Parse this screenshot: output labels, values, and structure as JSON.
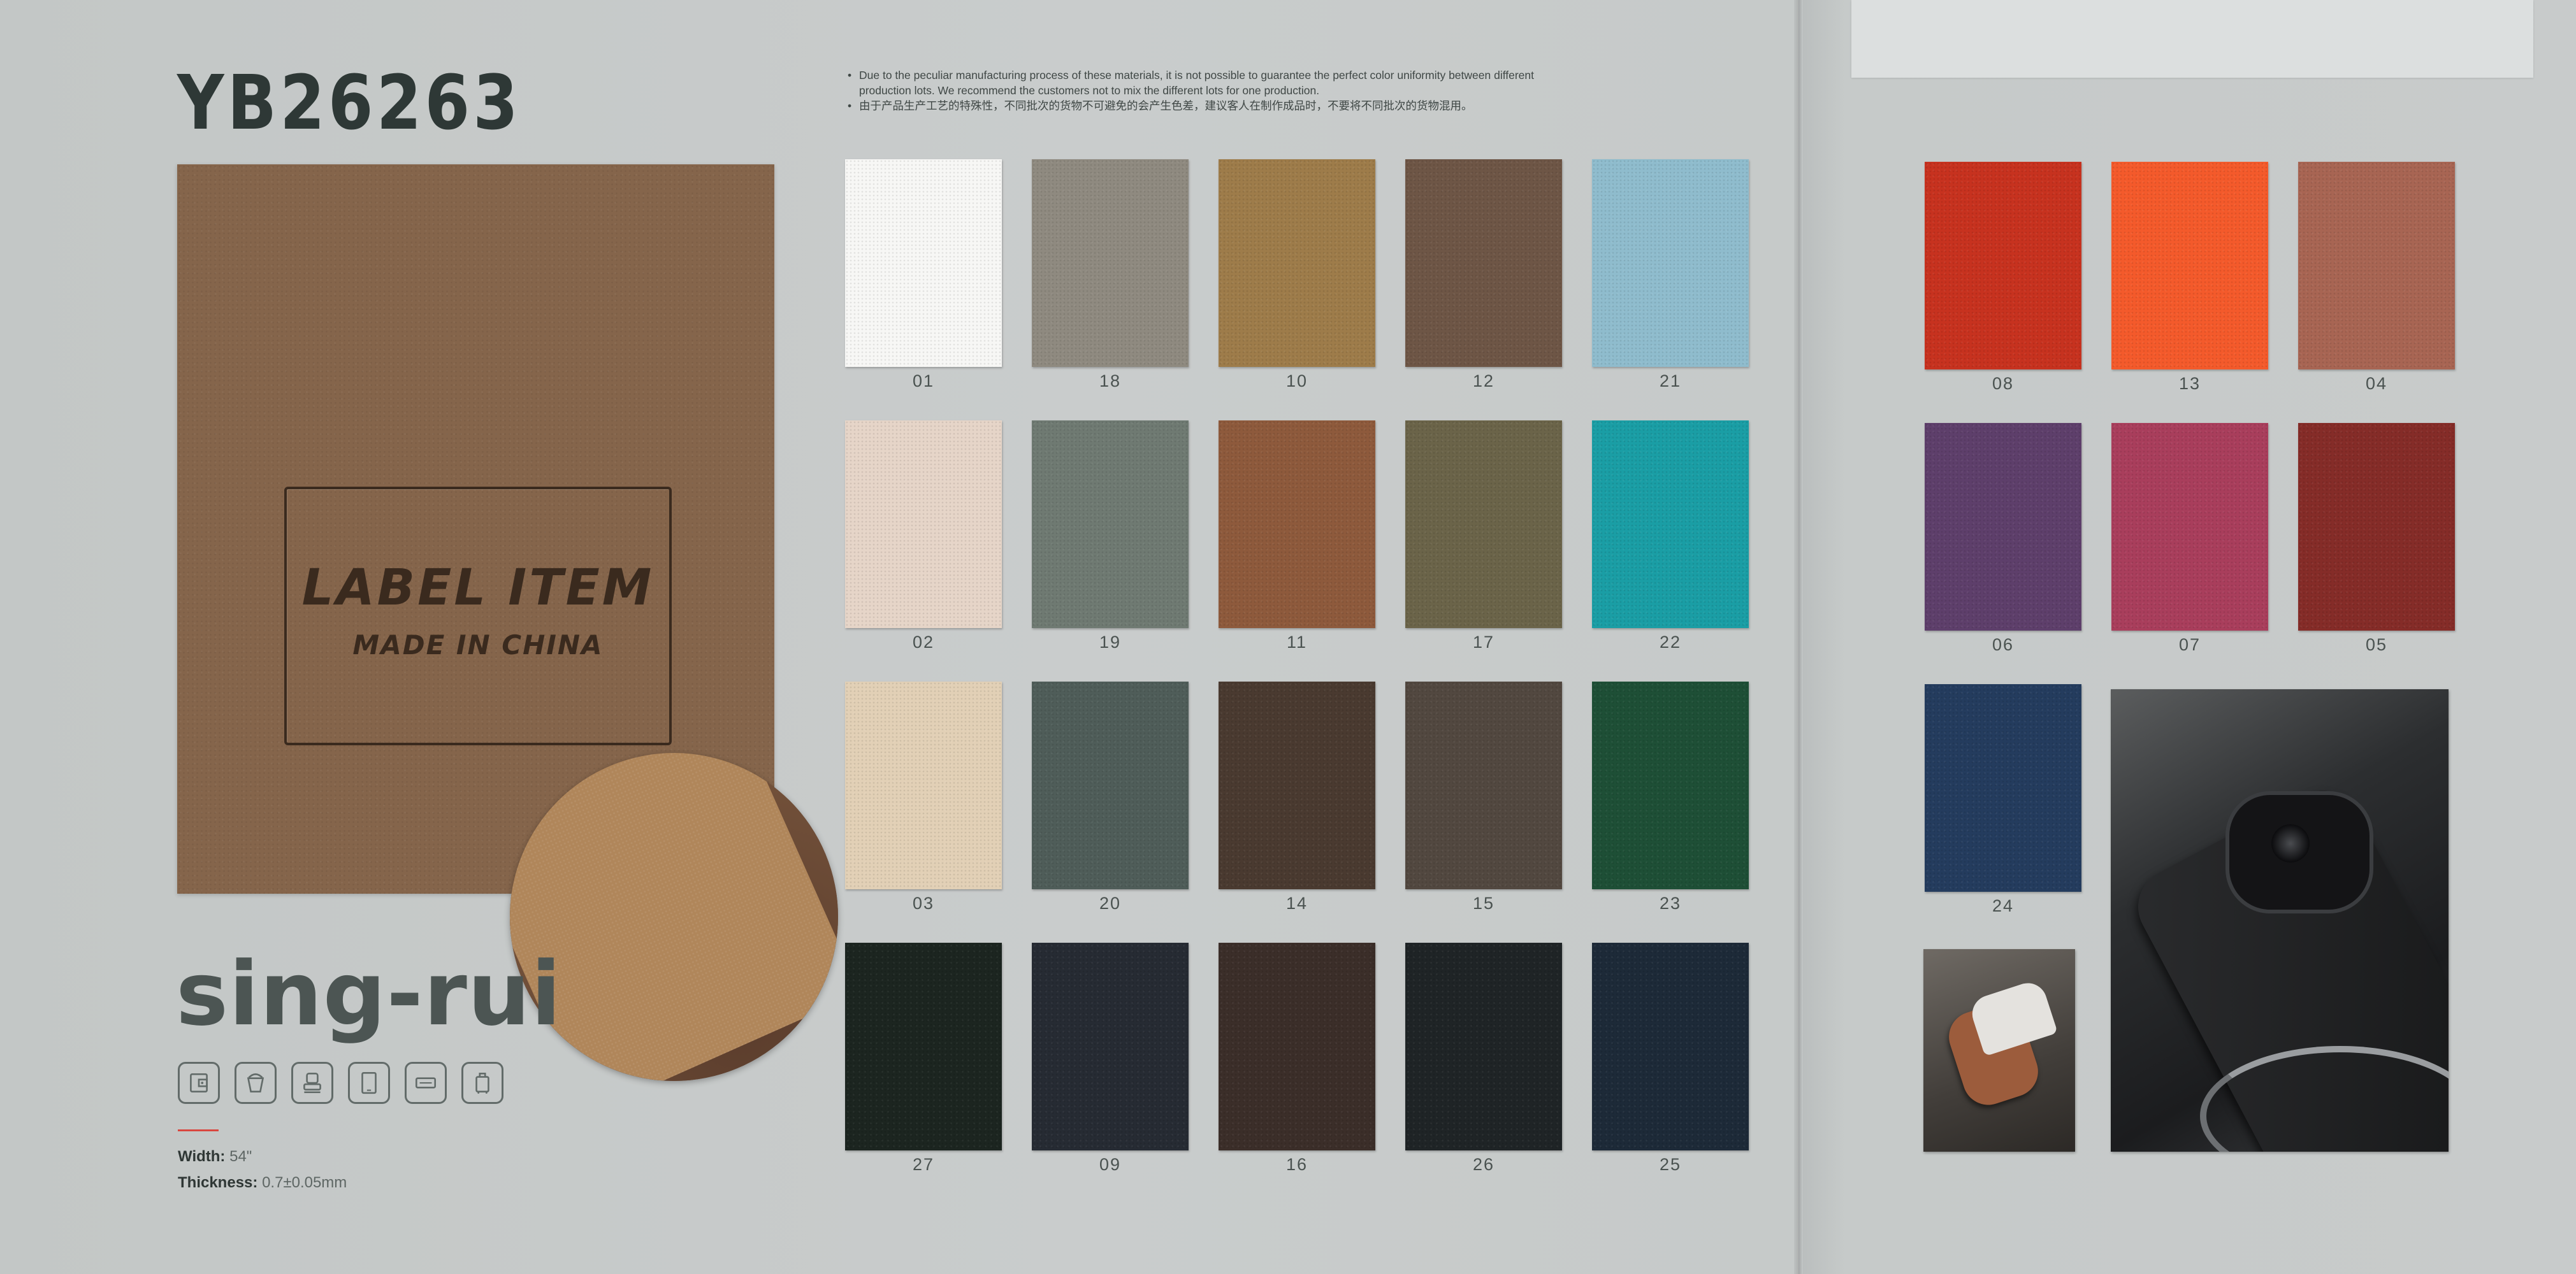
{
  "product": {
    "code": "YB26263",
    "brand": "sing-rui",
    "label_title": "LABEL ITEM",
    "label_subtitle": "MADE IN CHINA",
    "feature_color": "#85654b"
  },
  "notes": [
    "Due to the peculiar manufacturing process of these materials, it is not possible to guarantee the perfect color uniformity between different production lots. We recommend the customers not to mix the different lots for one production.",
    "由于产品生产工艺的特殊性，不同批次的货物不可避免的会产生色差，建议客人在制作成品时，不要将不同批次的货物混用。"
  ],
  "specs": {
    "width_label": "Width:",
    "width_value": "54\"",
    "thickness_label": "Thickness:",
    "thickness_value": "0.7±0.05mm"
  },
  "application_icons": [
    "wallet-icon",
    "bag-icon",
    "seat-icon",
    "tablet-icon",
    "label-icon",
    "luggage-icon"
  ],
  "swatches_left": [
    {
      "number": "01",
      "color": "#f7f7f5"
    },
    {
      "number": "18",
      "color": "#8f8a80"
    },
    {
      "number": "10",
      "color": "#9e7c4a"
    },
    {
      "number": "12",
      "color": "#6e5646"
    },
    {
      "number": "21",
      "color": "#8fbccd"
    },
    {
      "number": "02",
      "color": "#e6d5c8"
    },
    {
      "number": "19",
      "color": "#6f7a72"
    },
    {
      "number": "11",
      "color": "#8e5a3c"
    },
    {
      "number": "17",
      "color": "#6b6449"
    },
    {
      "number": "22",
      "color": "#1a9ea5"
    },
    {
      "number": "03",
      "color": "#e2d0b6"
    },
    {
      "number": "20",
      "color": "#4f5d59"
    },
    {
      "number": "14",
      "color": "#4a3a30"
    },
    {
      "number": "15",
      "color": "#524840"
    },
    {
      "number": "23",
      "color": "#1e4f36"
    },
    {
      "number": "27",
      "color": "#1c2520"
    },
    {
      "number": "09",
      "color": "#262b33"
    },
    {
      "number": "16",
      "color": "#3b2e29"
    },
    {
      "number": "26",
      "color": "#1f2426"
    },
    {
      "number": "25",
      "color": "#1d2a38"
    }
  ],
  "swatches_right": [
    {
      "number": "08",
      "color": "#c7321f"
    },
    {
      "number": "13",
      "color": "#f45a2b"
    },
    {
      "number": "04",
      "color": "#a86553"
    },
    {
      "number": "06",
      "color": "#5e3f6b"
    },
    {
      "number": "07",
      "color": "#a93e5c"
    },
    {
      "number": "05",
      "color": "#852c28"
    },
    {
      "number": "24",
      "color": "#243c5e"
    }
  ]
}
